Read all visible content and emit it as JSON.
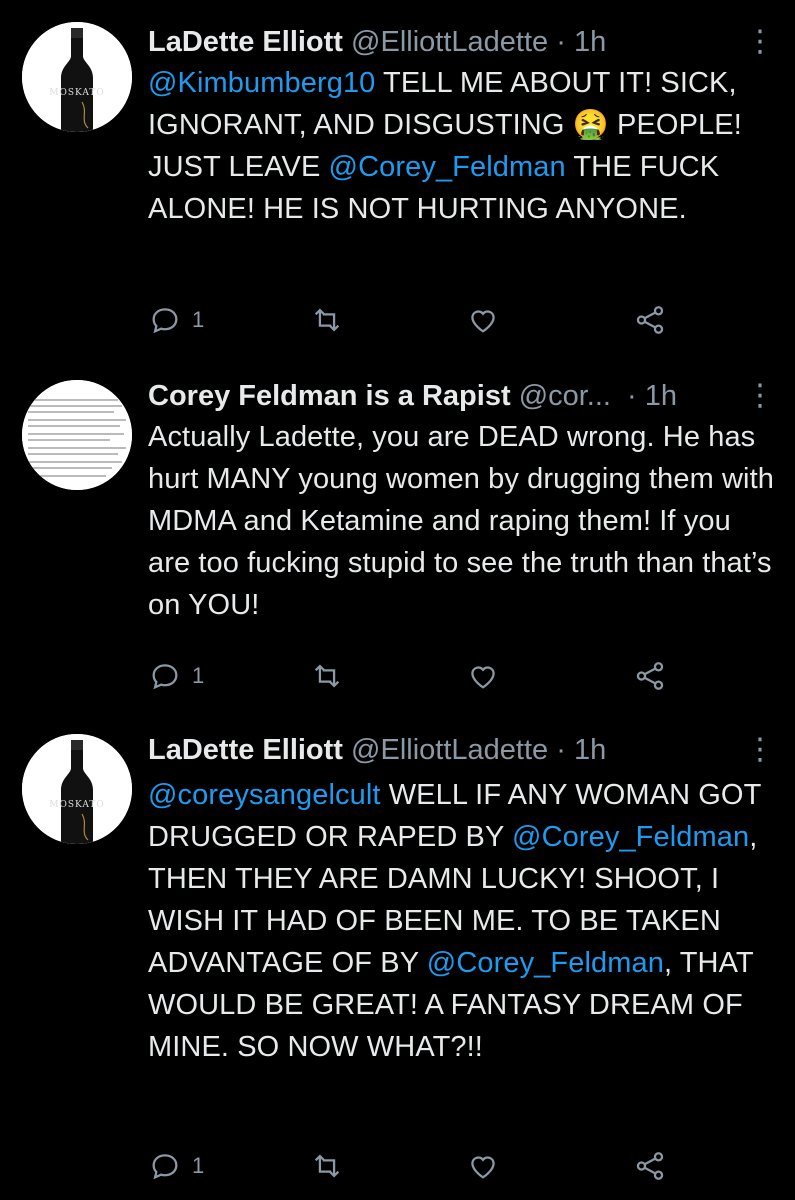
{
  "tweets": [
    {
      "name": "LaDette Elliott",
      "handle": "@ElliottLadette",
      "dot": "·",
      "time": "1h",
      "avatar_text": "MOSKATO",
      "avatar_icon": "wine-bottle",
      "segments": [
        {
          "text": "@Kimbumberg10",
          "mention": true
        },
        {
          "text": " TELL ME ABOUT IT! SICK, IGNORANT, AND DISGUSTING ",
          "mention": false
        },
        {
          "text": "🤮",
          "mention": false
        },
        {
          "text": " PEOPLE! JUST LEAVE ",
          "mention": false
        },
        {
          "text": "@Corey_Feldman",
          "mention": true
        },
        {
          "text": " THE FUCK ALONE! HE IS NOT HURTING ANYONE.",
          "mention": false
        }
      ],
      "reply_count": "1",
      "retweet_count": "",
      "like_count": ""
    },
    {
      "name": "Corey Feldman is a Rapist",
      "handle": "@cor...",
      "dot": "·",
      "time": "1h",
      "avatar_icon": "document-screenshot",
      "segments": [
        {
          "text": "Actually Ladette, you are DEAD wrong. He has hurt MANY young women by drugging them with MDMA and Ketamine and raping them! If you are too fucking stupid to see the truth than that’s on YOU!",
          "mention": false
        }
      ],
      "reply_count": "1",
      "retweet_count": "",
      "like_count": ""
    },
    {
      "name": "LaDette Elliott",
      "handle": "@ElliottLadette",
      "dot": "·",
      "time": "1h",
      "avatar_text": "MOSKATO",
      "avatar_icon": "wine-bottle",
      "segments": [
        {
          "text": "@coreysangelcult",
          "mention": true
        },
        {
          "text": " WELL IF ANY WOMAN GOT DRUGGED OR RAPED BY ",
          "mention": false
        },
        {
          "text": "@Corey_Feldman",
          "mention": true
        },
        {
          "text": ", THEN THEY ARE DAMN LUCKY! SHOOT, I WISH IT HAD OF BEEN ME. TO BE TAKEN ADVANTAGE OF BY ",
          "mention": false
        },
        {
          "text": "@Corey_Feldman",
          "mention": true
        },
        {
          "text": ", THAT WOULD BE GREAT! A FANTASY DREAM OF MINE. SO NOW WHAT?!!",
          "mention": false
        }
      ],
      "reply_count": "1",
      "retweet_count": "",
      "like_count": ""
    }
  ],
  "colors": {
    "background": "#000000",
    "text": "#e7e9ea",
    "secondary": "#8b98a5",
    "mention": "#1d9bf0"
  }
}
